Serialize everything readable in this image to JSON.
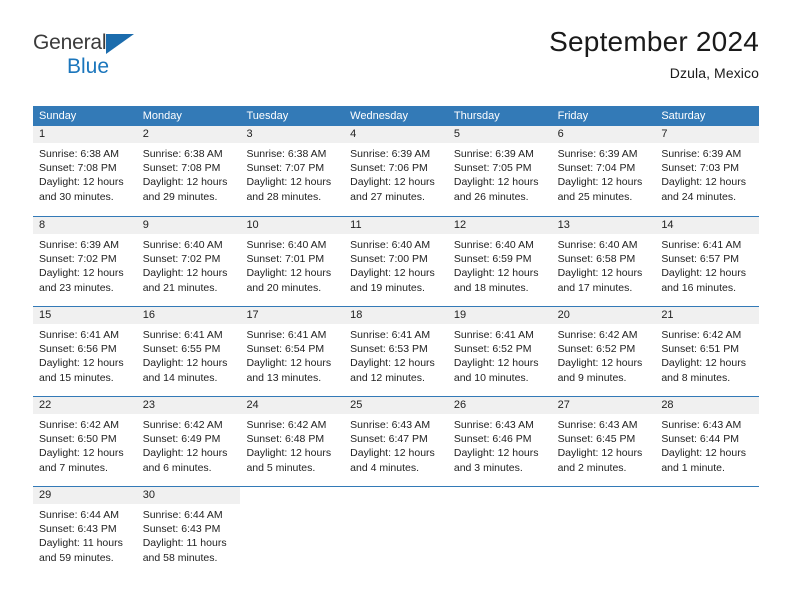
{
  "brand": {
    "name_part1": "General",
    "name_part2": "Blue",
    "logo_icon": "triangle-flag-icon"
  },
  "header": {
    "title": "September 2024",
    "subtitle": "Dzula, Mexico"
  },
  "calendar": {
    "weekday_headers": [
      "Sunday",
      "Monday",
      "Tuesday",
      "Wednesday",
      "Thursday",
      "Friday",
      "Saturday"
    ],
    "accent_color": "#337ab7",
    "daynum_bg": "#f0f0f0",
    "weeks": [
      [
        {
          "day": "1",
          "sunrise": "Sunrise: 6:38 AM",
          "sunset": "Sunset: 7:08 PM",
          "daylight1": "Daylight: 12 hours",
          "daylight2": "and 30 minutes."
        },
        {
          "day": "2",
          "sunrise": "Sunrise: 6:38 AM",
          "sunset": "Sunset: 7:08 PM",
          "daylight1": "Daylight: 12 hours",
          "daylight2": "and 29 minutes."
        },
        {
          "day": "3",
          "sunrise": "Sunrise: 6:38 AM",
          "sunset": "Sunset: 7:07 PM",
          "daylight1": "Daylight: 12 hours",
          "daylight2": "and 28 minutes."
        },
        {
          "day": "4",
          "sunrise": "Sunrise: 6:39 AM",
          "sunset": "Sunset: 7:06 PM",
          "daylight1": "Daylight: 12 hours",
          "daylight2": "and 27 minutes."
        },
        {
          "day": "5",
          "sunrise": "Sunrise: 6:39 AM",
          "sunset": "Sunset: 7:05 PM",
          "daylight1": "Daylight: 12 hours",
          "daylight2": "and 26 minutes."
        },
        {
          "day": "6",
          "sunrise": "Sunrise: 6:39 AM",
          "sunset": "Sunset: 7:04 PM",
          "daylight1": "Daylight: 12 hours",
          "daylight2": "and 25 minutes."
        },
        {
          "day": "7",
          "sunrise": "Sunrise: 6:39 AM",
          "sunset": "Sunset: 7:03 PM",
          "daylight1": "Daylight: 12 hours",
          "daylight2": "and 24 minutes."
        }
      ],
      [
        {
          "day": "8",
          "sunrise": "Sunrise: 6:39 AM",
          "sunset": "Sunset: 7:02 PM",
          "daylight1": "Daylight: 12 hours",
          "daylight2": "and 23 minutes."
        },
        {
          "day": "9",
          "sunrise": "Sunrise: 6:40 AM",
          "sunset": "Sunset: 7:02 PM",
          "daylight1": "Daylight: 12 hours",
          "daylight2": "and 21 minutes."
        },
        {
          "day": "10",
          "sunrise": "Sunrise: 6:40 AM",
          "sunset": "Sunset: 7:01 PM",
          "daylight1": "Daylight: 12 hours",
          "daylight2": "and 20 minutes."
        },
        {
          "day": "11",
          "sunrise": "Sunrise: 6:40 AM",
          "sunset": "Sunset: 7:00 PM",
          "daylight1": "Daylight: 12 hours",
          "daylight2": "and 19 minutes."
        },
        {
          "day": "12",
          "sunrise": "Sunrise: 6:40 AM",
          "sunset": "Sunset: 6:59 PM",
          "daylight1": "Daylight: 12 hours",
          "daylight2": "and 18 minutes."
        },
        {
          "day": "13",
          "sunrise": "Sunrise: 6:40 AM",
          "sunset": "Sunset: 6:58 PM",
          "daylight1": "Daylight: 12 hours",
          "daylight2": "and 17 minutes."
        },
        {
          "day": "14",
          "sunrise": "Sunrise: 6:41 AM",
          "sunset": "Sunset: 6:57 PM",
          "daylight1": "Daylight: 12 hours",
          "daylight2": "and 16 minutes."
        }
      ],
      [
        {
          "day": "15",
          "sunrise": "Sunrise: 6:41 AM",
          "sunset": "Sunset: 6:56 PM",
          "daylight1": "Daylight: 12 hours",
          "daylight2": "and 15 minutes."
        },
        {
          "day": "16",
          "sunrise": "Sunrise: 6:41 AM",
          "sunset": "Sunset: 6:55 PM",
          "daylight1": "Daylight: 12 hours",
          "daylight2": "and 14 minutes."
        },
        {
          "day": "17",
          "sunrise": "Sunrise: 6:41 AM",
          "sunset": "Sunset: 6:54 PM",
          "daylight1": "Daylight: 12 hours",
          "daylight2": "and 13 minutes."
        },
        {
          "day": "18",
          "sunrise": "Sunrise: 6:41 AM",
          "sunset": "Sunset: 6:53 PM",
          "daylight1": "Daylight: 12 hours",
          "daylight2": "and 12 minutes."
        },
        {
          "day": "19",
          "sunrise": "Sunrise: 6:41 AM",
          "sunset": "Sunset: 6:52 PM",
          "daylight1": "Daylight: 12 hours",
          "daylight2": "and 10 minutes."
        },
        {
          "day": "20",
          "sunrise": "Sunrise: 6:42 AM",
          "sunset": "Sunset: 6:52 PM",
          "daylight1": "Daylight: 12 hours",
          "daylight2": "and 9 minutes."
        },
        {
          "day": "21",
          "sunrise": "Sunrise: 6:42 AM",
          "sunset": "Sunset: 6:51 PM",
          "daylight1": "Daylight: 12 hours",
          "daylight2": "and 8 minutes."
        }
      ],
      [
        {
          "day": "22",
          "sunrise": "Sunrise: 6:42 AM",
          "sunset": "Sunset: 6:50 PM",
          "daylight1": "Daylight: 12 hours",
          "daylight2": "and 7 minutes."
        },
        {
          "day": "23",
          "sunrise": "Sunrise: 6:42 AM",
          "sunset": "Sunset: 6:49 PM",
          "daylight1": "Daylight: 12 hours",
          "daylight2": "and 6 minutes."
        },
        {
          "day": "24",
          "sunrise": "Sunrise: 6:42 AM",
          "sunset": "Sunset: 6:48 PM",
          "daylight1": "Daylight: 12 hours",
          "daylight2": "and 5 minutes."
        },
        {
          "day": "25",
          "sunrise": "Sunrise: 6:43 AM",
          "sunset": "Sunset: 6:47 PM",
          "daylight1": "Daylight: 12 hours",
          "daylight2": "and 4 minutes."
        },
        {
          "day": "26",
          "sunrise": "Sunrise: 6:43 AM",
          "sunset": "Sunset: 6:46 PM",
          "daylight1": "Daylight: 12 hours",
          "daylight2": "and 3 minutes."
        },
        {
          "day": "27",
          "sunrise": "Sunrise: 6:43 AM",
          "sunset": "Sunset: 6:45 PM",
          "daylight1": "Daylight: 12 hours",
          "daylight2": "and 2 minutes."
        },
        {
          "day": "28",
          "sunrise": "Sunrise: 6:43 AM",
          "sunset": "Sunset: 6:44 PM",
          "daylight1": "Daylight: 12 hours",
          "daylight2": "and 1 minute."
        }
      ],
      [
        {
          "day": "29",
          "sunrise": "Sunrise: 6:44 AM",
          "sunset": "Sunset: 6:43 PM",
          "daylight1": "Daylight: 11 hours",
          "daylight2": "and 59 minutes."
        },
        {
          "day": "30",
          "sunrise": "Sunrise: 6:44 AM",
          "sunset": "Sunset: 6:43 PM",
          "daylight1": "Daylight: 11 hours",
          "daylight2": "and 58 minutes."
        },
        {
          "day": "",
          "sunrise": "",
          "sunset": "",
          "daylight1": "",
          "daylight2": ""
        },
        {
          "day": "",
          "sunrise": "",
          "sunset": "",
          "daylight1": "",
          "daylight2": ""
        },
        {
          "day": "",
          "sunrise": "",
          "sunset": "",
          "daylight1": "",
          "daylight2": ""
        },
        {
          "day": "",
          "sunrise": "",
          "sunset": "",
          "daylight1": "",
          "daylight2": ""
        },
        {
          "day": "",
          "sunrise": "",
          "sunset": "",
          "daylight1": "",
          "daylight2": ""
        }
      ]
    ]
  }
}
